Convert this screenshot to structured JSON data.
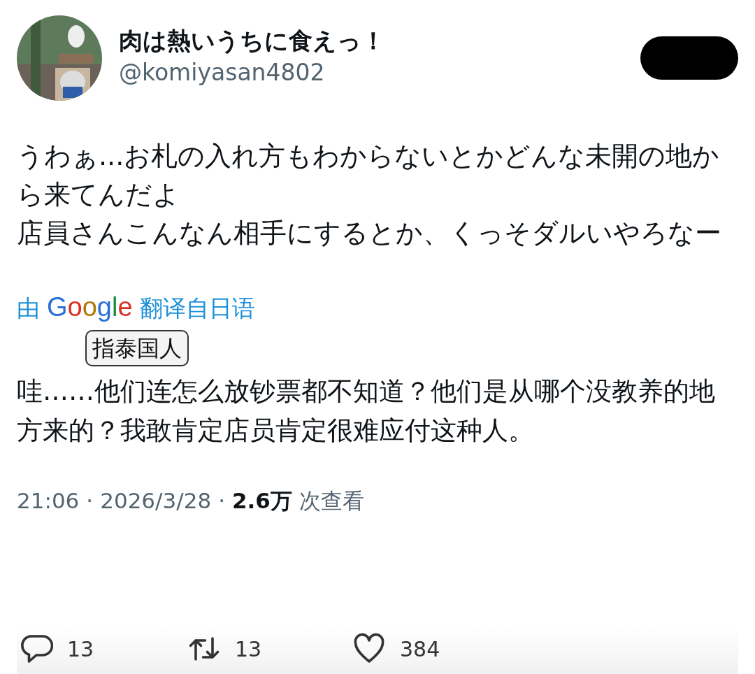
{
  "author": {
    "display_name": "肉は熱いうちに食えっ！",
    "handle": "@komiyasan4802"
  },
  "tweet_text": [
    "うわぁ...お札の入れ方もわからないとかどんな未開の地から来てんだよ",
    "店員さんこんなん相手にするとか、くっそダルいやろなー"
  ],
  "translation": {
    "prefix": "由",
    "logo": "Google",
    "suffix": "翻译自日语",
    "sticker": "指泰国人",
    "text": "哇……他们连怎么放钞票都不知道？他们是从哪个没教养的地方来的？我敢肯定店员肯定很难应付这种人。"
  },
  "meta": {
    "time": "21:06",
    "separator": "·",
    "date": "2026/3/28",
    "views": "**2.6万** 次查看"
  },
  "actions": [
    {
      "kind": "reply",
      "count": "13"
    },
    {
      "kind": "retweet",
      "count": "13"
    },
    {
      "kind": "like",
      "count": "384"
    }
  ]
}
